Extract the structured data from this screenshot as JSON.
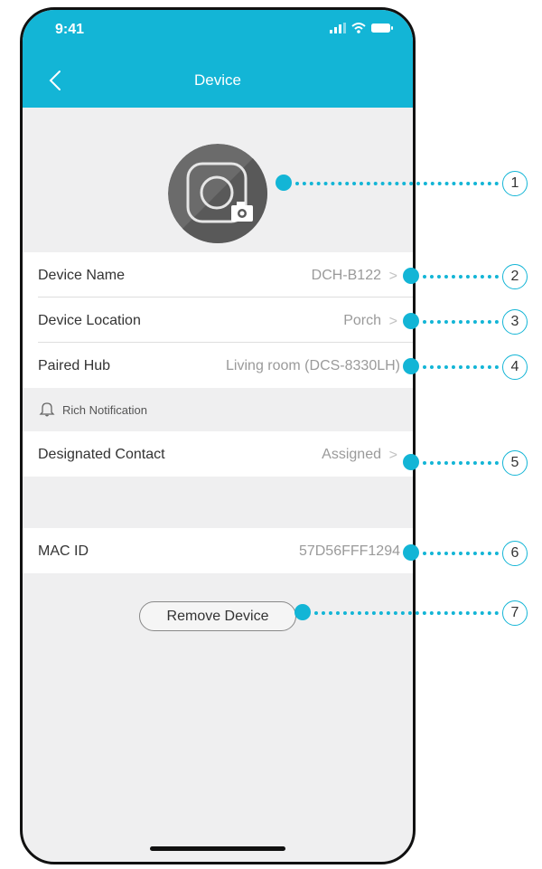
{
  "status_bar": {
    "time": "9:41"
  },
  "nav": {
    "title": "Device"
  },
  "rows": {
    "device_name": {
      "label": "Device Name",
      "value": "DCH-B122"
    },
    "device_location": {
      "label": "Device Location",
      "value": "Porch"
    },
    "paired_hub": {
      "label": "Paired Hub",
      "value": "Living room (DCS-8330LH)"
    },
    "designated_contact": {
      "label": "Designated Contact",
      "value": "Assigned"
    },
    "mac_id": {
      "label": "MAC ID",
      "value": "57D56FFF1294"
    }
  },
  "section": {
    "rich_notification": "Rich Notification"
  },
  "buttons": {
    "remove_device": "Remove Device"
  },
  "callouts": [
    "1",
    "2",
    "3",
    "4",
    "5",
    "6",
    "7"
  ],
  "colors": {
    "accent": "#13b5d6",
    "background": "#efeff0",
    "row": "#ffffff"
  },
  "icons": [
    "signal-icon",
    "wifi-icon",
    "battery-icon",
    "back-arrow-icon",
    "camera-icon",
    "bell-icon",
    "chevron-right-icon"
  ]
}
